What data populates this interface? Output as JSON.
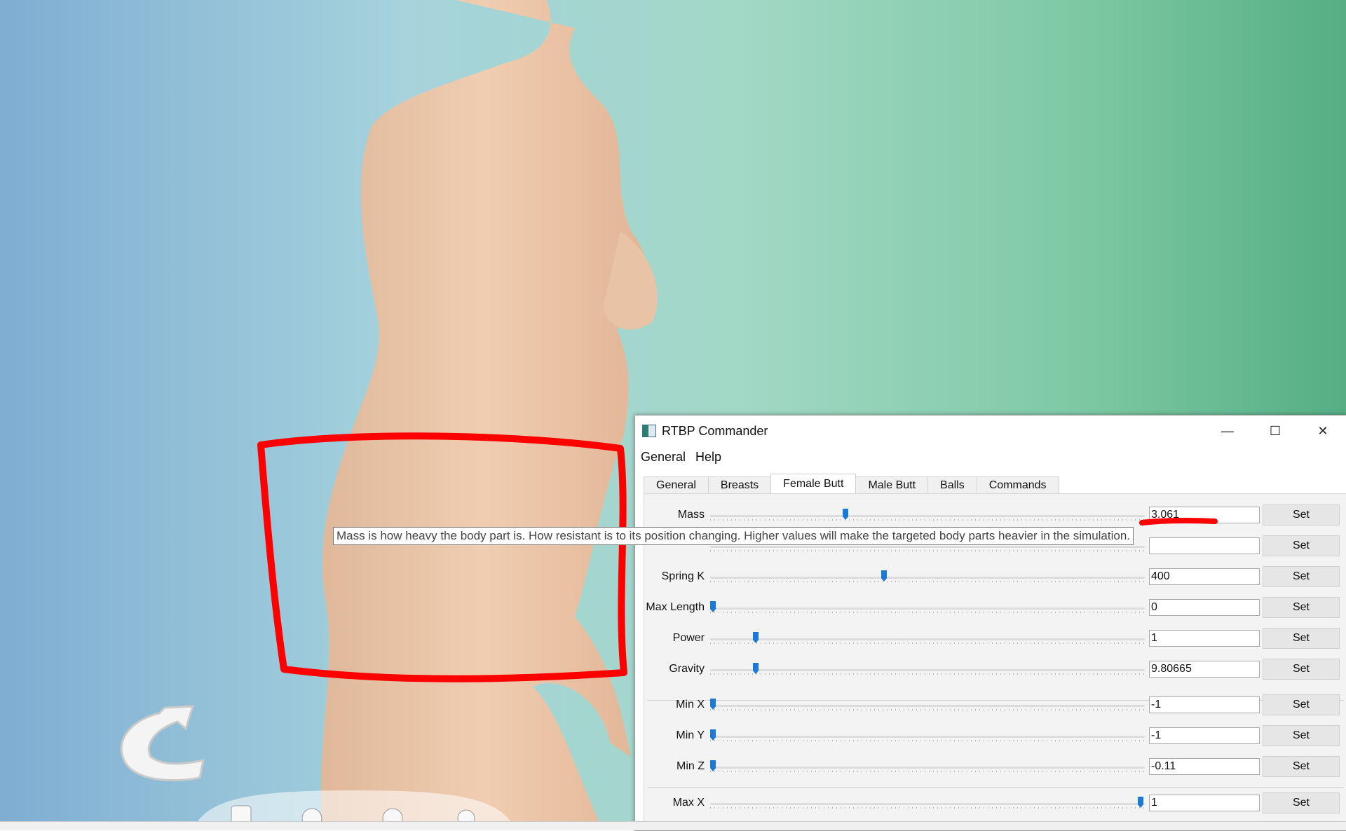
{
  "window": {
    "title": "RTBP Commander",
    "icon": "app-icon",
    "controls": {
      "minimize": "—",
      "maximize": "☐",
      "close": "✕"
    }
  },
  "menubar": {
    "items": [
      "General",
      "Help"
    ]
  },
  "tabs": [
    "General",
    "Breasts",
    "Female Butt",
    "Male Butt",
    "Balls",
    "Commands"
  ],
  "active_tab": "Female Butt",
  "rows": [
    {
      "label": "Mass",
      "value": "3.061",
      "slider": 0.31
    },
    {
      "label": "",
      "value": "",
      "slider": null
    },
    {
      "label": "Spring K",
      "value": "400",
      "slider": 0.4
    },
    {
      "label": "Max Length",
      "value": "0",
      "slider": 0.0
    },
    {
      "label": "Power",
      "value": "1",
      "slider": 0.1
    },
    {
      "label": "Gravity",
      "value": "9.80665",
      "slider": 0.1
    },
    {
      "label": "Min X",
      "value": "-1",
      "slider": 0.0
    },
    {
      "label": "Min Y",
      "value": "-1",
      "slider": 0.0
    },
    {
      "label": "Min Z",
      "value": "-0.11",
      "slider": 0.0
    },
    {
      "label": "Max X",
      "value": "1",
      "slider": 1.0
    }
  ],
  "set_label": "Set",
  "tooltip": "Mass is how heavy the body part is. How resistant is to its position changing. Higher values will make the targeted body parts heavier in the simulation.",
  "annotation_color": "#ff0000"
}
